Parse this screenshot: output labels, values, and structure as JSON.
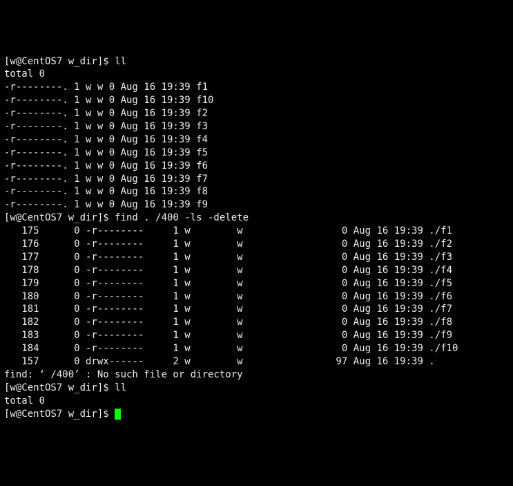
{
  "prompt": {
    "user": "w",
    "host": "CentOS7",
    "dir": "w_dir",
    "symbol": "$"
  },
  "commands": {
    "cmd1": "ll",
    "cmd2": "find . /400 -ls -delete",
    "cmd3": "ll",
    "cmd4": ""
  },
  "ll1_total": "total 0",
  "ll1_rows": [
    {
      "perm": "-r--------.",
      "links": "1",
      "owner": "w",
      "group": "w",
      "size": "0",
      "date": "Aug 16 19:39",
      "name": "f1"
    },
    {
      "perm": "-r--------.",
      "links": "1",
      "owner": "w",
      "group": "w",
      "size": "0",
      "date": "Aug 16 19:39",
      "name": "f10"
    },
    {
      "perm": "-r--------.",
      "links": "1",
      "owner": "w",
      "group": "w",
      "size": "0",
      "date": "Aug 16 19:39",
      "name": "f2"
    },
    {
      "perm": "-r--------.",
      "links": "1",
      "owner": "w",
      "group": "w",
      "size": "0",
      "date": "Aug 16 19:39",
      "name": "f3"
    },
    {
      "perm": "-r--------.",
      "links": "1",
      "owner": "w",
      "group": "w",
      "size": "0",
      "date": "Aug 16 19:39",
      "name": "f4"
    },
    {
      "perm": "-r--------.",
      "links": "1",
      "owner": "w",
      "group": "w",
      "size": "0",
      "date": "Aug 16 19:39",
      "name": "f5"
    },
    {
      "perm": "-r--------.",
      "links": "1",
      "owner": "w",
      "group": "w",
      "size": "0",
      "date": "Aug 16 19:39",
      "name": "f6"
    },
    {
      "perm": "-r--------.",
      "links": "1",
      "owner": "w",
      "group": "w",
      "size": "0",
      "date": "Aug 16 19:39",
      "name": "f7"
    },
    {
      "perm": "-r--------.",
      "links": "1",
      "owner": "w",
      "group": "w",
      "size": "0",
      "date": "Aug 16 19:39",
      "name": "f8"
    },
    {
      "perm": "-r--------.",
      "links": "1",
      "owner": "w",
      "group": "w",
      "size": "0",
      "date": "Aug 16 19:39",
      "name": "f9"
    }
  ],
  "find_rows": [
    {
      "inode": "175",
      "blk": "0",
      "perm": "-r--------",
      "links": "1",
      "owner": "w",
      "group": "w",
      "size": "0",
      "date": "Aug 16 19:39",
      "name": "./f1"
    },
    {
      "inode": "176",
      "blk": "0",
      "perm": "-r--------",
      "links": "1",
      "owner": "w",
      "group": "w",
      "size": "0",
      "date": "Aug 16 19:39",
      "name": "./f2"
    },
    {
      "inode": "177",
      "blk": "0",
      "perm": "-r--------",
      "links": "1",
      "owner": "w",
      "group": "w",
      "size": "0",
      "date": "Aug 16 19:39",
      "name": "./f3"
    },
    {
      "inode": "178",
      "blk": "0",
      "perm": "-r--------",
      "links": "1",
      "owner": "w",
      "group": "w",
      "size": "0",
      "date": "Aug 16 19:39",
      "name": "./f4"
    },
    {
      "inode": "179",
      "blk": "0",
      "perm": "-r--------",
      "links": "1",
      "owner": "w",
      "group": "w",
      "size": "0",
      "date": "Aug 16 19:39",
      "name": "./f5"
    },
    {
      "inode": "180",
      "blk": "0",
      "perm": "-r--------",
      "links": "1",
      "owner": "w",
      "group": "w",
      "size": "0",
      "date": "Aug 16 19:39",
      "name": "./f6"
    },
    {
      "inode": "181",
      "blk": "0",
      "perm": "-r--------",
      "links": "1",
      "owner": "w",
      "group": "w",
      "size": "0",
      "date": "Aug 16 19:39",
      "name": "./f7"
    },
    {
      "inode": "182",
      "blk": "0",
      "perm": "-r--------",
      "links": "1",
      "owner": "w",
      "group": "w",
      "size": "0",
      "date": "Aug 16 19:39",
      "name": "./f8"
    },
    {
      "inode": "183",
      "blk": "0",
      "perm": "-r--------",
      "links": "1",
      "owner": "w",
      "group": "w",
      "size": "0",
      "date": "Aug 16 19:39",
      "name": "./f9"
    },
    {
      "inode": "184",
      "blk": "0",
      "perm": "-r--------",
      "links": "1",
      "owner": "w",
      "group": "w",
      "size": "0",
      "date": "Aug 16 19:39",
      "name": "./f10"
    },
    {
      "inode": "157",
      "blk": "0",
      "perm": "drwx------",
      "links": "2",
      "owner": "w",
      "group": "w",
      "size": "97",
      "date": "Aug 16 19:39",
      "name": "."
    }
  ],
  "find_error": "find: ‘ /400’ : No such file or directory",
  "ll2_total": "total 0"
}
